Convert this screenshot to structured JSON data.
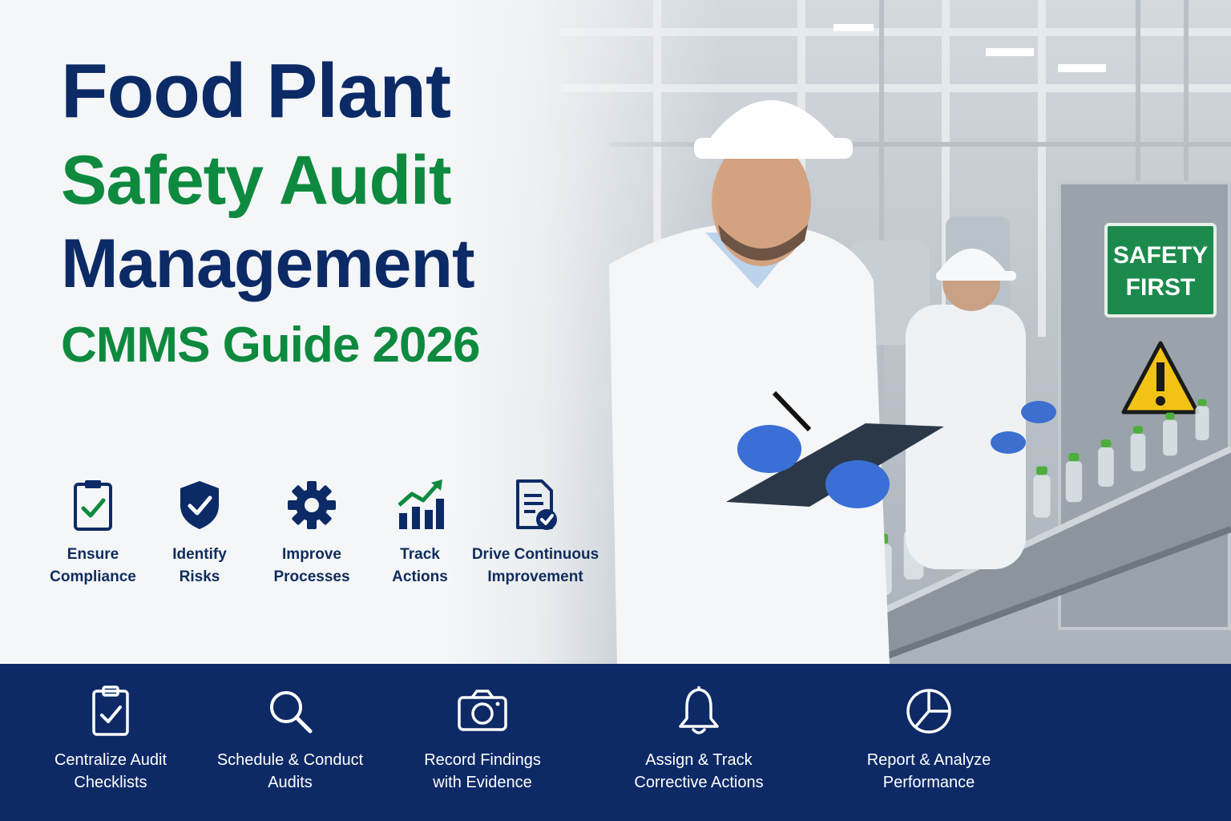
{
  "headline": {
    "line1": "Food Plant",
    "line2": "Safety Audit",
    "line3": "Management",
    "line4": "CMMS Guide 2026"
  },
  "benefits": [
    {
      "icon": "clipboard-check-icon",
      "line1": "Ensure",
      "line2": "Compliance"
    },
    {
      "icon": "shield-check-icon",
      "line1": "Identify",
      "line2": "Risks"
    },
    {
      "icon": "gear-icon",
      "line1": "Improve",
      "line2": "Processes"
    },
    {
      "icon": "growth-chart-icon",
      "line1": "Track",
      "line2": "Actions"
    },
    {
      "icon": "document-check-icon",
      "line1": "Drive Continuous",
      "line2": "Improvement"
    }
  ],
  "features": [
    {
      "icon": "clipboard-check-icon",
      "line1": "Centralize Audit",
      "line2": "Checklists"
    },
    {
      "icon": "search-icon",
      "line1": "Schedule & Conduct",
      "line2": "Audits"
    },
    {
      "icon": "camera-icon",
      "line1": "Record Findings",
      "line2": "with Evidence"
    },
    {
      "icon": "bell-icon",
      "line1": "Assign & Track",
      "line2": "Corrective Actions"
    },
    {
      "icon": "pie-chart-icon",
      "line1": "Report & Analyze",
      "line2": "Performance"
    }
  ],
  "photo": {
    "sign_line1": "SAFETY",
    "sign_line2": "FIRST"
  },
  "colors": {
    "navy": "#0b2a66",
    "green": "#0e8a3e",
    "band": "#0d2a66"
  }
}
